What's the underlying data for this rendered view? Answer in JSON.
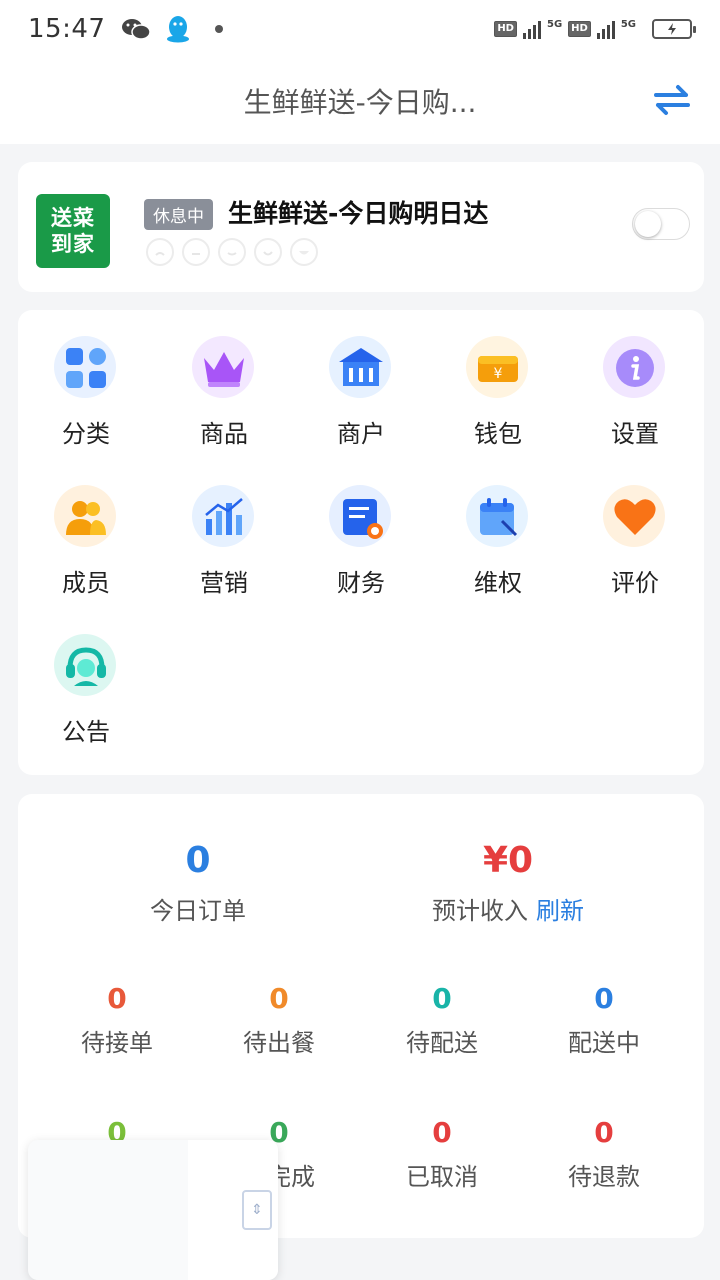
{
  "status_bar": {
    "time": "15:47",
    "hd1": "HD",
    "net1": "5G",
    "hd2": "HD",
    "net2": "5G"
  },
  "header": {
    "title": "生鲜鲜送-今日购..."
  },
  "store": {
    "logo_line1": "送菜",
    "logo_line2": "到家",
    "status_badge": "休息中",
    "name": "生鲜鲜送-今日购明日达"
  },
  "menu": {
    "items": [
      {
        "label": "分类",
        "icon": "category-icon"
      },
      {
        "label": "商品",
        "icon": "crown-icon"
      },
      {
        "label": "商户",
        "icon": "bank-icon"
      },
      {
        "label": "钱包",
        "icon": "wallet-icon"
      },
      {
        "label": "设置",
        "icon": "info-icon"
      },
      {
        "label": "成员",
        "icon": "members-icon"
      },
      {
        "label": "营销",
        "icon": "bar-chart-icon"
      },
      {
        "label": "财务",
        "icon": "finance-icon"
      },
      {
        "label": "维权",
        "icon": "calendar-icon"
      },
      {
        "label": "评价",
        "icon": "heart-icon"
      },
      {
        "label": "公告",
        "icon": "headset-icon"
      }
    ]
  },
  "stats": {
    "today_orders": {
      "value": "0",
      "label": "今日订单"
    },
    "expected_income": {
      "value": "¥0",
      "label": "预计收入",
      "refresh": "刷新"
    },
    "row1": [
      {
        "value": "0",
        "label": "待接单",
        "color": "#e8593a"
      },
      {
        "value": "0",
        "label": "待出餐",
        "color": "#f08a2a"
      },
      {
        "value": "0",
        "label": "待配送",
        "color": "#19b4a8"
      },
      {
        "value": "0",
        "label": "配送中",
        "color": "#2b7fe0"
      }
    ],
    "row2": [
      {
        "value": "0",
        "label": "",
        "color": "#7bbf3a"
      },
      {
        "value": "0",
        "label": "已完成",
        "color": "#3aa85a"
      },
      {
        "value": "0",
        "label": "已取消",
        "color": "#e53e3e"
      },
      {
        "value": "0",
        "label": "待退款",
        "color": "#e53e3e"
      }
    ]
  },
  "colors": {
    "accent_blue": "#2b7fe0",
    "income_red": "#e53e3e",
    "logo_green": "#1a9a48"
  }
}
